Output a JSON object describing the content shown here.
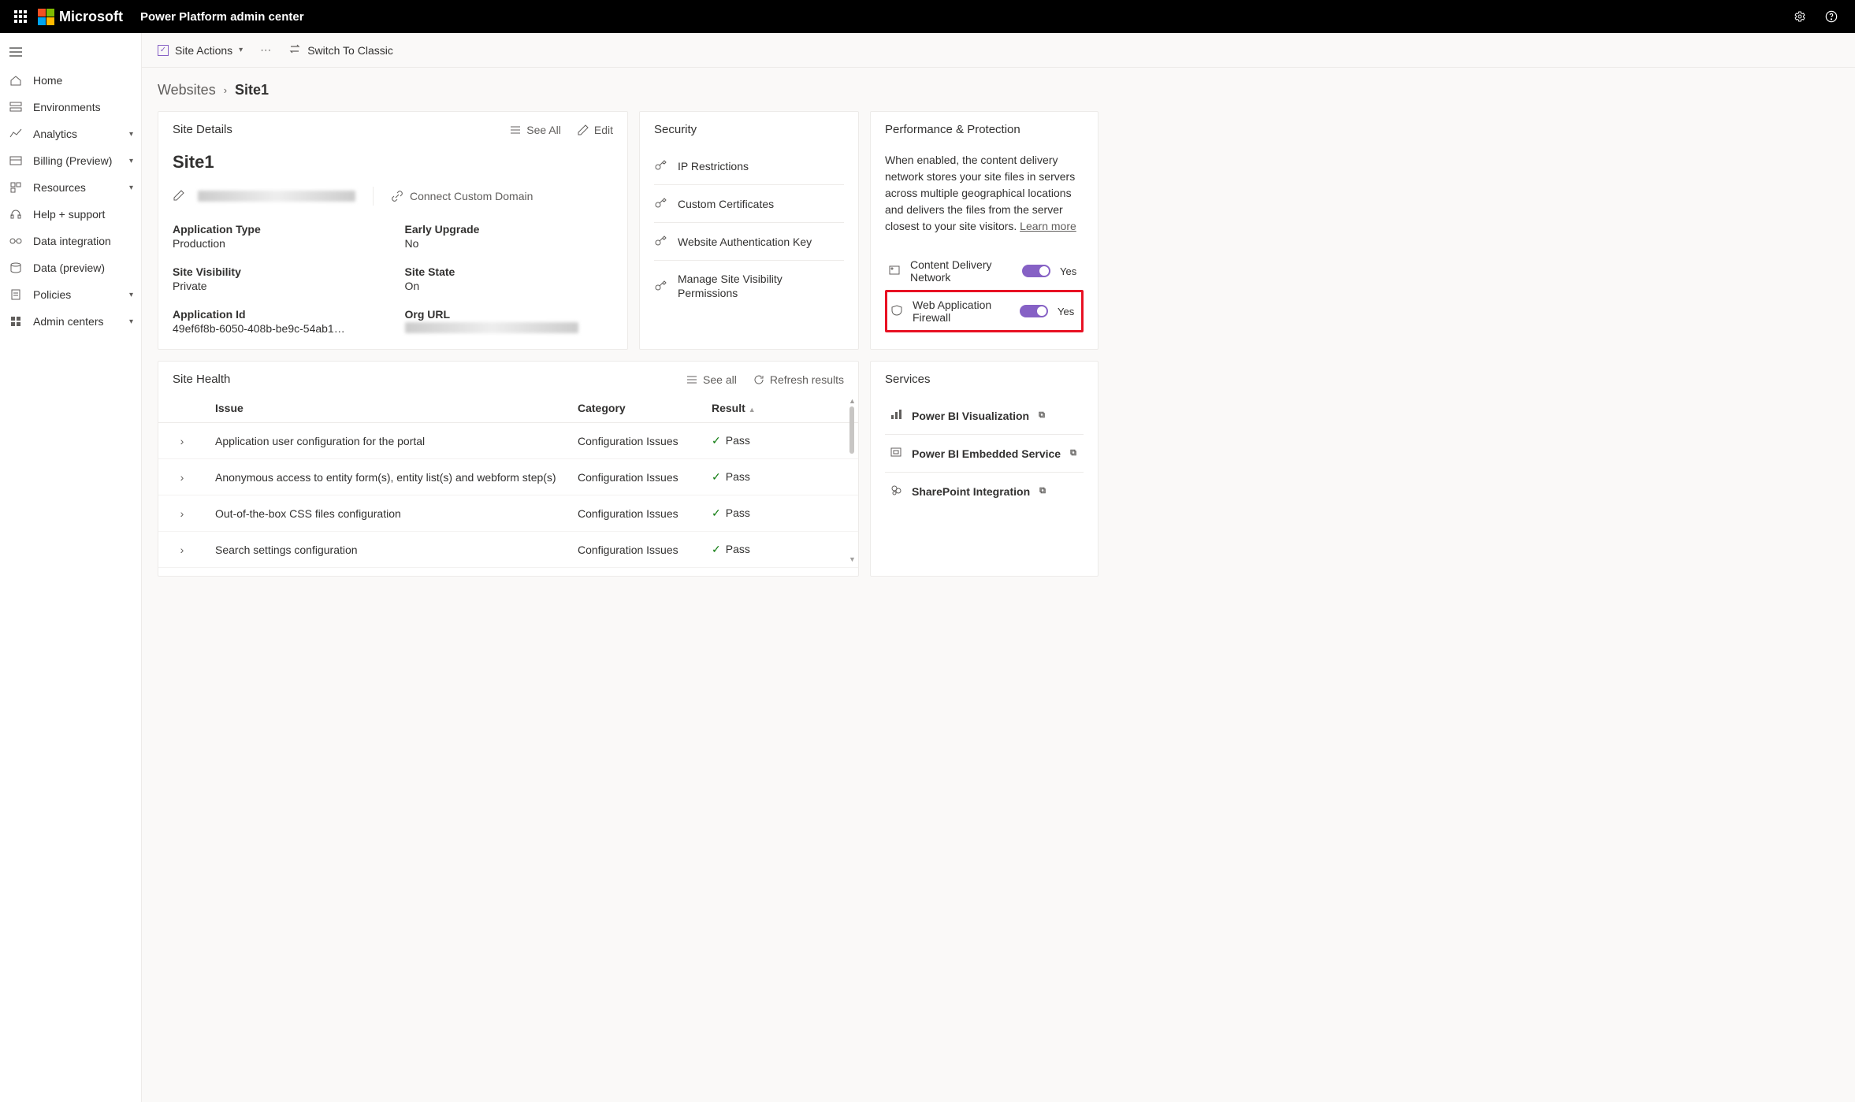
{
  "header": {
    "brand": "Microsoft",
    "app_title": "Power Platform admin center"
  },
  "sidebar": {
    "items": [
      {
        "label": "Home",
        "expandable": false
      },
      {
        "label": "Environments",
        "expandable": false
      },
      {
        "label": "Analytics",
        "expandable": true
      },
      {
        "label": "Billing (Preview)",
        "expandable": true
      },
      {
        "label": "Resources",
        "expandable": true
      },
      {
        "label": "Help + support",
        "expandable": false
      },
      {
        "label": "Data integration",
        "expandable": false
      },
      {
        "label": "Data (preview)",
        "expandable": false
      },
      {
        "label": "Policies",
        "expandable": true
      },
      {
        "label": "Admin centers",
        "expandable": true
      }
    ]
  },
  "command_bar": {
    "site_actions": "Site Actions",
    "switch": "Switch To Classic"
  },
  "breadcrumb": {
    "root": "Websites",
    "current": "Site1"
  },
  "site_details": {
    "title": "Site Details",
    "see_all": "See All",
    "edit": "Edit",
    "site_name": "Site1",
    "connect_domain": "Connect Custom Domain",
    "fields": {
      "app_type": {
        "label": "Application Type",
        "value": "Production"
      },
      "early_upgrade": {
        "label": "Early Upgrade",
        "value": "No"
      },
      "visibility": {
        "label": "Site Visibility",
        "value": "Private"
      },
      "site_state": {
        "label": "Site State",
        "value": "On"
      },
      "app_id": {
        "label": "Application Id",
        "value": "49ef6f8b-6050-408b-be9c-54ab173c9..."
      },
      "org_url": {
        "label": "Org URL",
        "value": ""
      }
    }
  },
  "security": {
    "title": "Security",
    "items": [
      "IP Restrictions",
      "Custom Certificates",
      "Website Authentication Key",
      "Manage Site Visibility Permissions"
    ]
  },
  "perf": {
    "title": "Performance & Protection",
    "desc": "When enabled, the content delivery network stores your site files in servers across multiple geographical locations and delivers the files from the server closest to your site visitors. ",
    "learn_more": "Learn more",
    "toggles": [
      {
        "label": "Content Delivery Network",
        "state": "Yes",
        "highlight": false
      },
      {
        "label": "Web Application Firewall",
        "state": "Yes",
        "highlight": true
      }
    ]
  },
  "health": {
    "title": "Site Health",
    "see_all": "See all",
    "refresh": "Refresh results",
    "columns": {
      "issue": "Issue",
      "category": "Category",
      "result": "Result"
    },
    "rows": [
      {
        "issue": "Application user configuration for the portal",
        "category": "Configuration Issues",
        "result": "Pass"
      },
      {
        "issue": "Anonymous access to entity form(s), entity list(s) and webform step(s)",
        "category": "Configuration Issues",
        "result": "Pass"
      },
      {
        "issue": "Out-of-the-box CSS files configuration",
        "category": "Configuration Issues",
        "result": "Pass"
      },
      {
        "issue": "Search settings configuration",
        "category": "Configuration Issues",
        "result": "Pass"
      }
    ]
  },
  "services": {
    "title": "Services",
    "items": [
      "Power BI Visualization",
      "Power BI Embedded Service",
      "SharePoint Integration"
    ]
  }
}
